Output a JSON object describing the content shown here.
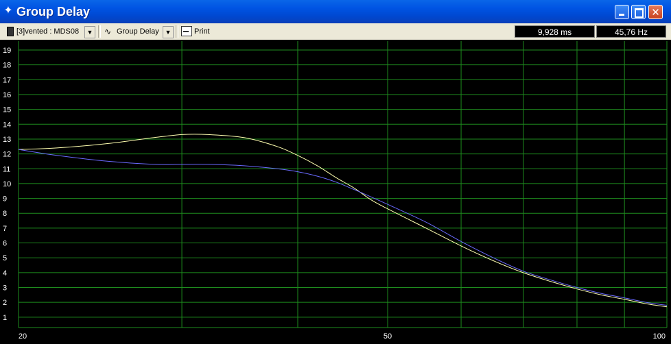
{
  "window": {
    "title": "Group Delay",
    "title_icon": "pin-icon"
  },
  "toolbar": {
    "document": "[3]vented : MDS08",
    "view_mode": "Group Delay",
    "print_label": "Print"
  },
  "readout": {
    "time": "9,928 ms",
    "frequency": "45,76 Hz"
  },
  "colors": {
    "plot_background": "#000000",
    "grid": "#1E8C1E",
    "trace_1": "#FFFFB0",
    "trace_2": "#6A6AFF",
    "label": "#FFFFFF"
  },
  "chart_data": {
    "type": "line",
    "xscale": "log",
    "xlim": [
      20,
      100
    ],
    "ylim": [
      0.3,
      19.6
    ],
    "y_ticks": [
      1,
      2,
      3,
      4,
      5,
      6,
      7,
      8,
      9,
      10,
      11,
      12,
      13,
      14,
      15,
      16,
      17,
      18,
      19
    ],
    "x_tick_labels": [
      "20",
      "50",
      "100"
    ],
    "x_label_values": [
      20,
      50,
      100
    ],
    "x_grid": [
      20,
      30,
      40,
      50,
      60,
      70,
      80,
      90,
      100
    ],
    "grid": true,
    "series": [
      {
        "color": "#FFFFB0",
        "x": [
          20,
          22,
          25,
          28,
          30,
          32,
          35,
          38,
          40,
          42,
          44,
          46,
          48,
          50,
          55,
          60,
          65,
          70,
          75,
          80,
          85,
          90,
          95,
          100
        ],
        "y": [
          12.3,
          12.4,
          12.7,
          13.1,
          13.3,
          13.3,
          13.1,
          12.5,
          11.9,
          11.2,
          10.4,
          9.7,
          8.9,
          8.3,
          7.0,
          5.8,
          4.8,
          4.0,
          3.4,
          2.9,
          2.5,
          2.2,
          1.9,
          1.7
        ]
      },
      {
        "color": "#6A6AFF",
        "x": [
          20,
          22,
          25,
          28,
          30,
          32,
          35,
          38,
          40,
          42,
          44,
          46,
          48,
          50,
          55,
          60,
          65,
          70,
          75,
          80,
          85,
          90,
          95,
          100
        ],
        "y": [
          12.3,
          11.9,
          11.5,
          11.3,
          11.3,
          11.3,
          11.2,
          11.0,
          10.8,
          10.5,
          10.1,
          9.6,
          9.1,
          8.6,
          7.4,
          6.1,
          5.0,
          4.1,
          3.5,
          3.0,
          2.6,
          2.3,
          2.0,
          1.8
        ]
      }
    ]
  }
}
